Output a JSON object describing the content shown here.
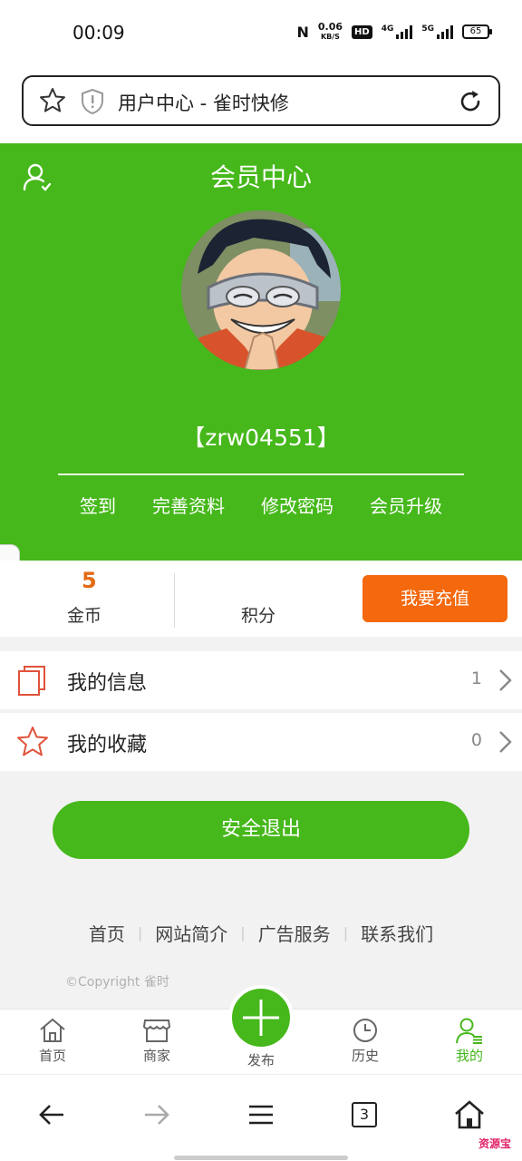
{
  "status_bar": {
    "time": "00:09",
    "speed_value": "0.06",
    "speed_unit": "KB/S",
    "hd": "HD",
    "net1": "4G",
    "net2": "5G",
    "battery": "65"
  },
  "address_bar": {
    "title": "用户中心 - 雀时快修"
  },
  "header": {
    "title": "会员中心",
    "username": "【zrw04551】",
    "links": [
      "签到",
      "完善资料",
      "修改密码",
      "会员升级"
    ]
  },
  "stats": {
    "coins_value": "5",
    "coins_label": "金币",
    "points_label": "积分",
    "recharge_label": "我要充值"
  },
  "list": [
    {
      "label": "我的信息",
      "count": "1"
    },
    {
      "label": "我的收藏",
      "count": "0"
    }
  ],
  "logout_label": "安全退出",
  "footer": {
    "links": [
      "首页",
      "网站简介",
      "广告服务",
      "联系我们"
    ],
    "copyright": "©Copyright  雀时"
  },
  "tab_bar": {
    "items": [
      "首页",
      "商家",
      "发布",
      "历史",
      "我的"
    ],
    "active": "我的"
  },
  "browser_nav": {
    "tab_count": "3"
  },
  "corner_tag": "资源宝",
  "colors": {
    "primary_green": "#46b81b",
    "recharge_orange": "#f4680e",
    "coin_orange": "#e36a12",
    "icon_red": "#e0533a"
  }
}
